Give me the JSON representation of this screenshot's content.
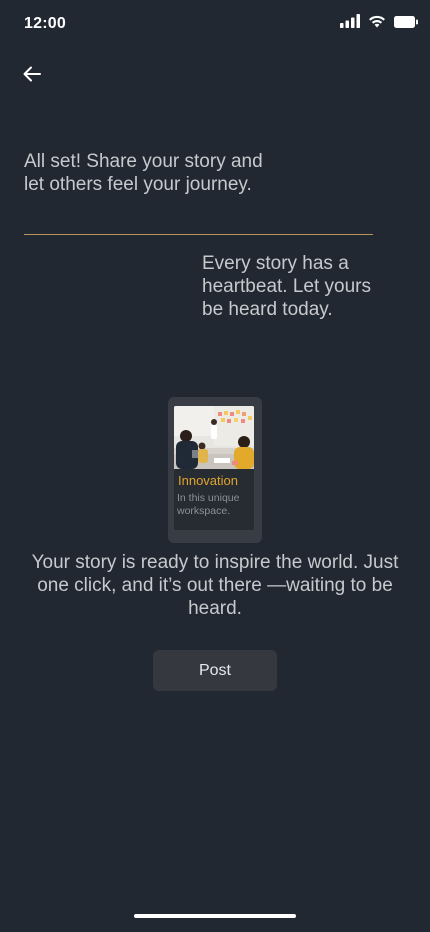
{
  "status_bar": {
    "time": "12:00",
    "icons": [
      "cellular-signal-icon",
      "wifi-icon",
      "battery-icon"
    ]
  },
  "nav": {
    "back_icon": "arrow-left-icon"
  },
  "content": {
    "intro": "All set! Share your story and let others feel your journey.",
    "heartbeat": "Every story has a heartbeat. Let yours be heard today.",
    "preview": {
      "title": "Innovation",
      "subtitle": "In this unique workspace.",
      "image": "team-meeting-photo"
    },
    "inspire": "Your story is ready to inspire the world. Just one click, and it’s out there —waiting to be heard.",
    "post_button_label": "Post"
  },
  "colors": {
    "background": "#222831",
    "accent": "#e0a32e",
    "divider": "#b8955c",
    "button_bg": "#35393f",
    "text": "#c6c9ce"
  }
}
